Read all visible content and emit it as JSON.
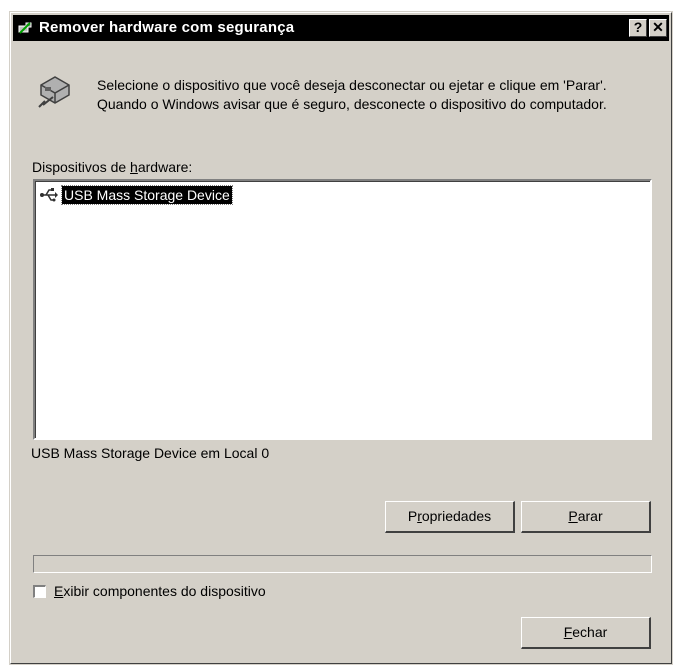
{
  "window": {
    "title": "Remover hardware com segurança",
    "help_glyph": "?",
    "close_glyph": "✕"
  },
  "instructions": "Selecione o dispositivo que você deseja desconectar ou ejetar e clique em 'Parar'. Quando o Windows avisar que é seguro, desconecte o dispositivo do computador.",
  "devices": {
    "label_pre": "Dispositivos de ",
    "label_key": "h",
    "label_post": "ardware:",
    "items": [
      {
        "label": "USB Mass Storage Device",
        "icon": "usb-icon",
        "selected": true
      }
    ]
  },
  "status_text": "USB Mass Storage Device em Local 0",
  "buttons": {
    "properties": {
      "pre": "P",
      "key": "r",
      "post": "opriedades"
    },
    "stop": {
      "pre": "",
      "key": "P",
      "post": "arar"
    },
    "close": {
      "pre": "",
      "key": "F",
      "post": "echar"
    }
  },
  "show_components": {
    "pre": "",
    "key": "E",
    "post": "xibir componentes do dispositivo",
    "checked": false
  }
}
